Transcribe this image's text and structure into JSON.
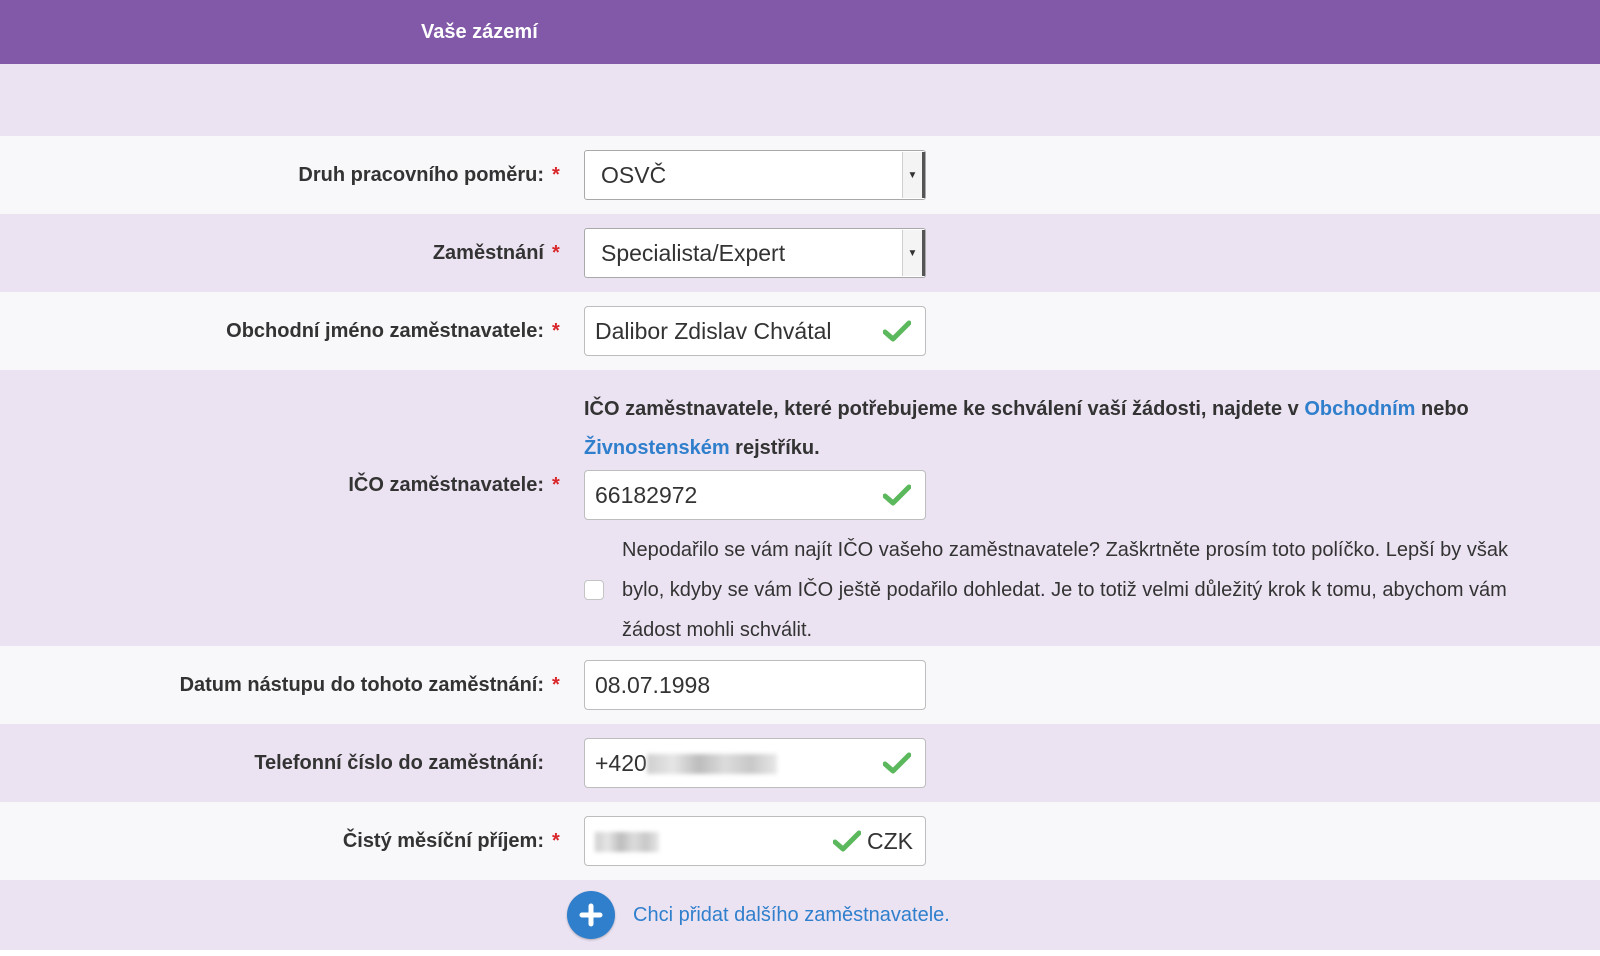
{
  "header": {
    "title": "Vaše zázemí"
  },
  "form": {
    "employment_type": {
      "label": "Druh pracovního poměru:",
      "required": "*",
      "value": "OSVČ"
    },
    "occupation": {
      "label": "Zaměstnání",
      "required": "*",
      "value": "Specialista/Expert"
    },
    "employer_name": {
      "label": "Obchodní jméno zaměstnavatele:",
      "required": "*",
      "value": "Dalibor Zdislav Chvátal"
    },
    "ico": {
      "label": "IČO zaměstnavatele:",
      "required": "*",
      "value": "66182972",
      "note_part1": "IČO zaměstnavatele, které potřebujeme ke schválení vaší žádosti, najdete v ",
      "note_link1": "Obchodním",
      "note_part2": " nebo ",
      "note_link2": "Živnostenském",
      "note_part3": " rejstříku.",
      "checkbox_text": "Nepodařilo se vám najít IČO vašeho zaměstnavatele? Zaškrtněte prosím toto políčko. Lepší by však bylo, kdyby se vám IČO ještě podařilo dohledat. Je to totiž velmi důležitý krok k tomu, abychom vám žádost mohli schválit."
    },
    "start_date": {
      "label": "Datum nástupu do tohoto zaměstnání:",
      "required": "*",
      "value": "08.07.1998"
    },
    "work_phone": {
      "label": "Telefonní číslo do zaměstnání:",
      "value_prefix": "+420"
    },
    "net_income": {
      "label": "Čistý měsíční příjem:",
      "required": "*",
      "currency": "CZK"
    },
    "add_employer": {
      "label": "Chci přidat dalšího zaměstnavatele."
    }
  },
  "colors": {
    "header": "#8159a8",
    "band": "#ece3f2",
    "link": "#2f7fcc",
    "valid": "#5cb85c",
    "required": "#d9262b"
  },
  "icons": {
    "valid": "checkmark-icon",
    "add": "plus-circle-icon",
    "dropdown": "caret-down-icon"
  }
}
